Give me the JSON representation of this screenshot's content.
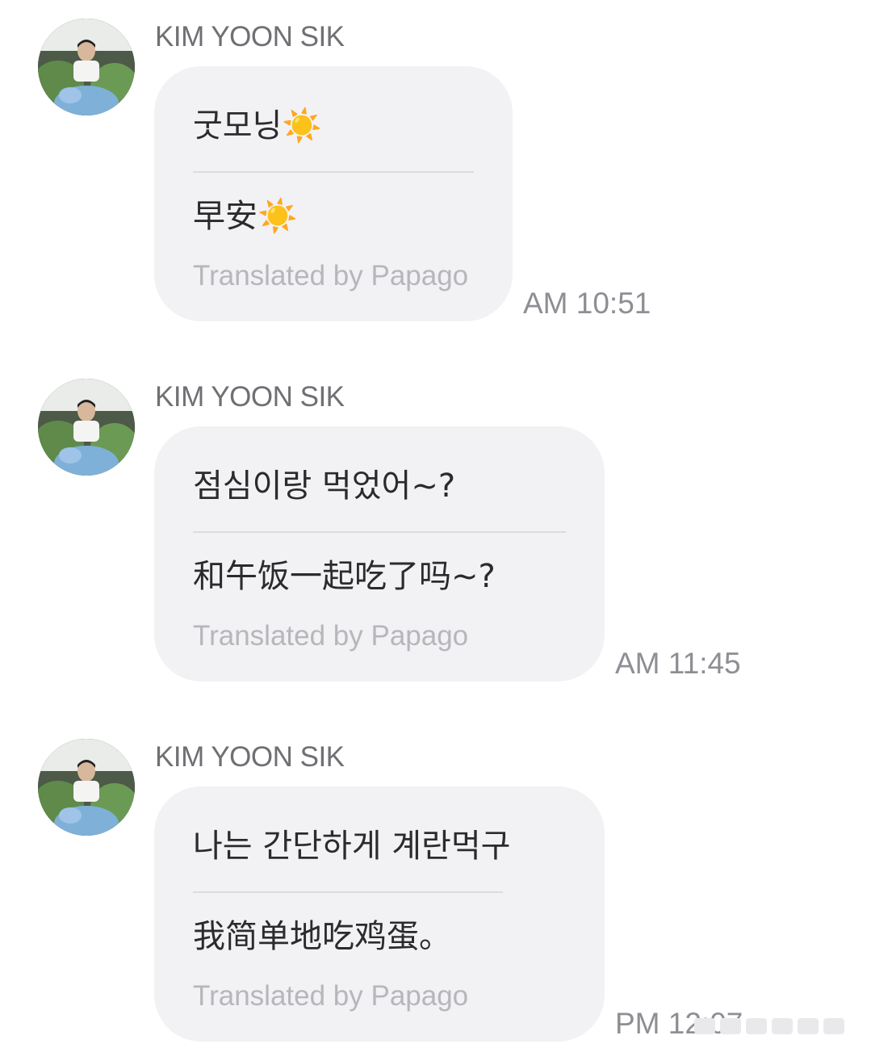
{
  "messages": [
    {
      "sender": "KIM YOON SIK",
      "original": "굿모닝☀️",
      "translated": "早安☀️",
      "credit": "Translated by Papago",
      "time": "AM 10:51"
    },
    {
      "sender": "KIM YOON SIK",
      "original": "점심이랑 먹었어~?",
      "translated": "和午饭一起吃了吗~?",
      "credit": "Translated by Papago",
      "time": "AM 11:45"
    },
    {
      "sender": "KIM YOON SIK",
      "original": "나는 간단하게 계란먹구",
      "translated": "我简单地吃鸡蛋。",
      "credit": "Translated by Papago",
      "time": "PM 12:07"
    }
  ],
  "colors": {
    "bubble_bg": "#f2f2f4",
    "sender_text": "#6f6f74",
    "message_text": "#2b2b2e",
    "credit_text": "#b6b6bc",
    "time_text": "#8e8e94"
  }
}
